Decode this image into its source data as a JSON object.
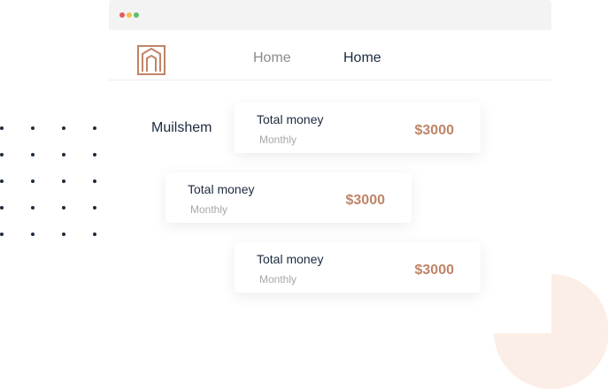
{
  "window": {
    "traffic_lights": [
      "#e85a5a",
      "#f2c14e",
      "#5ac06a"
    ]
  },
  "navbar": {
    "logo_icon": "house-outline-icon",
    "links": [
      {
        "label": "Home"
      },
      {
        "label": "Home"
      }
    ]
  },
  "brand": {
    "label": "Muilshem"
  },
  "cards": [
    {
      "title": "Total money",
      "subtitle": "Monthly",
      "amount": "$3000"
    },
    {
      "title": "Total money",
      "subtitle": "Monthly",
      "amount": "$3000"
    },
    {
      "title": "Total money",
      "subtitle": "Monthly",
      "amount": "$3000"
    }
  ],
  "colors": {
    "accent": "#c08467",
    "text_dark": "#1c2a3f",
    "text_muted": "#a7a7a7",
    "decor_circle": "#fbeee6",
    "titlebar": "#f3f3f3"
  }
}
